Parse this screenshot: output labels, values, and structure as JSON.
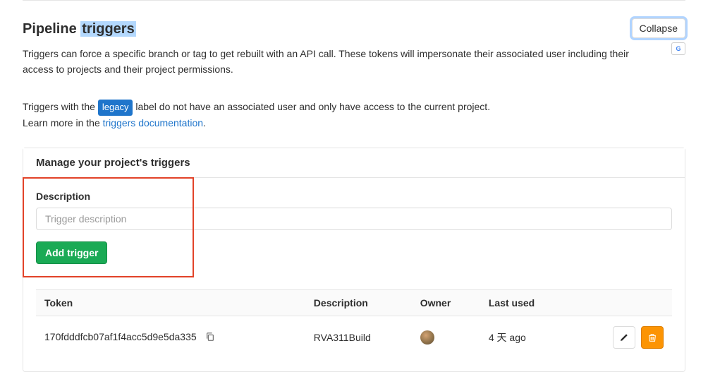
{
  "header": {
    "title_prefix": "Pipeline ",
    "title_highlight": "triggers",
    "collapse_label": "Collapse",
    "translate_badge": "G"
  },
  "intro": {
    "para1": "Triggers can force a specific branch or tag to get rebuilt with an API call. These tokens will impersonate their associated user including their access to projects and their project permissions.",
    "para2_pre": "Triggers with the ",
    "para2_badge": "legacy",
    "para2_post": " label do not have an associated user and only have access to the current project.",
    "learn_more_pre": "Learn more in the ",
    "learn_more_link": "triggers documentation",
    "learn_more_post": "."
  },
  "panel": {
    "manage_title": "Manage your project's triggers",
    "description_label": "Description",
    "description_placeholder": "Trigger description",
    "add_btn": "Add trigger"
  },
  "table": {
    "cols": {
      "token": "Token",
      "description": "Description",
      "owner": "Owner",
      "last_used": "Last used"
    },
    "rows": [
      {
        "token": "170fdddfcb07af1f4acc5d9e5da335",
        "description": "RVA311Build",
        "last_used": "4 天 ago"
      }
    ]
  }
}
